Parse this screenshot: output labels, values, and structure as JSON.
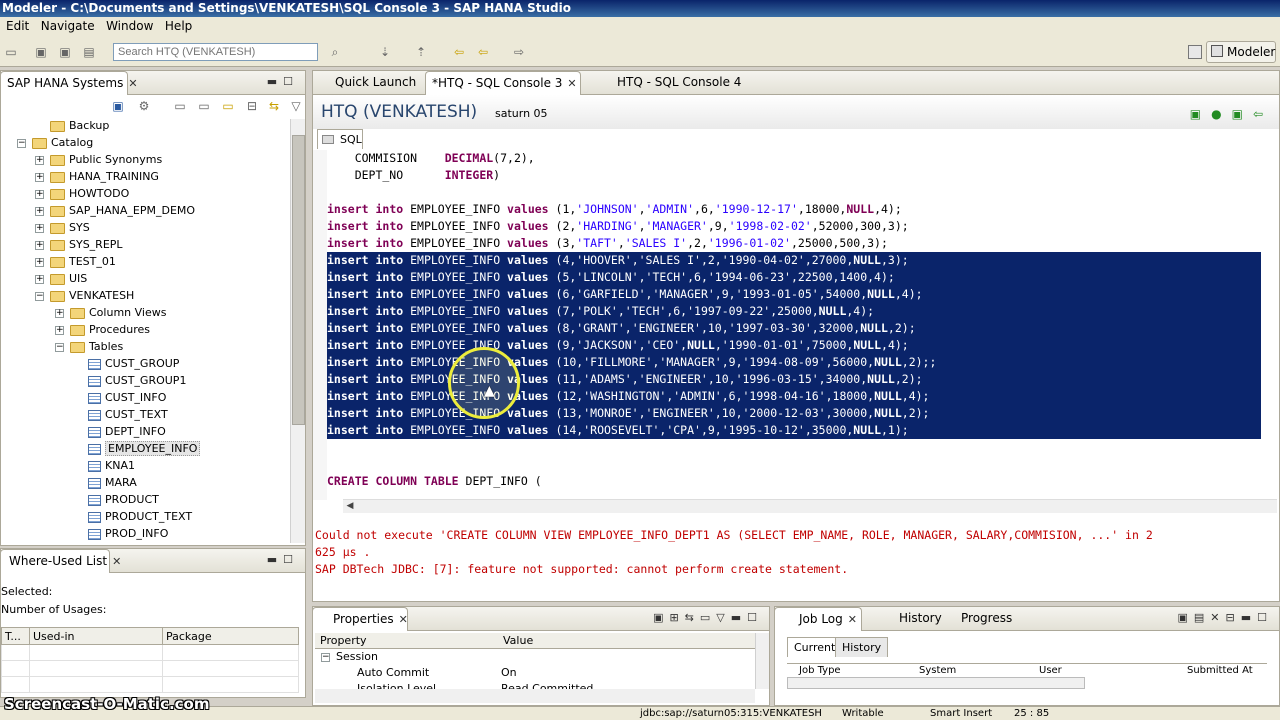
{
  "window": {
    "title": "Modeler - C:\\Documents and Settings\\VENKATESH\\SQL Console 3 - SAP HANA Studio"
  },
  "menu": [
    "Edit",
    "Navigate",
    "Window",
    "Help"
  ],
  "toolbar": {
    "search_placeholder": "Search HTQ (VENKATESH)",
    "perspective_label": "Modeler"
  },
  "systems_panel": {
    "tab_label": "SAP HANA Systems",
    "tree": [
      {
        "label": "Backup",
        "level": 2,
        "kind": "folder",
        "expander": ""
      },
      {
        "label": "Catalog",
        "level": 1,
        "kind": "folder",
        "expander": "−"
      },
      {
        "label": "Public Synonyms",
        "level": 2,
        "kind": "folder",
        "expander": "+"
      },
      {
        "label": "HANA_TRAINING",
        "level": 2,
        "kind": "folder",
        "expander": "+"
      },
      {
        "label": "HOWTODO",
        "level": 2,
        "kind": "folder",
        "expander": "+"
      },
      {
        "label": "SAP_HANA_EPM_DEMO",
        "level": 2,
        "kind": "folder",
        "expander": "+"
      },
      {
        "label": "SYS",
        "level": 2,
        "kind": "folder",
        "expander": "+"
      },
      {
        "label": "SYS_REPL",
        "level": 2,
        "kind": "folder",
        "expander": "+"
      },
      {
        "label": "TEST_01",
        "level": 2,
        "kind": "folder",
        "expander": "+"
      },
      {
        "label": "UIS",
        "level": 2,
        "kind": "folder",
        "expander": "+"
      },
      {
        "label": "VENKATESH",
        "level": 2,
        "kind": "folder",
        "expander": "−"
      },
      {
        "label": "Column Views",
        "level": 3,
        "kind": "folder",
        "expander": "+"
      },
      {
        "label": "Procedures",
        "level": 3,
        "kind": "folder",
        "expander": "+"
      },
      {
        "label": "Tables",
        "level": 3,
        "kind": "folder",
        "expander": "−"
      },
      {
        "label": "CUST_GROUP",
        "level": 4,
        "kind": "table",
        "expander": ""
      },
      {
        "label": "CUST_GROUP1",
        "level": 4,
        "kind": "table",
        "expander": ""
      },
      {
        "label": "CUST_INFO",
        "level": 4,
        "kind": "table",
        "expander": ""
      },
      {
        "label": "CUST_TEXT",
        "level": 4,
        "kind": "table",
        "expander": ""
      },
      {
        "label": "DEPT_INFO",
        "level": 4,
        "kind": "table",
        "expander": ""
      },
      {
        "label": "EMPLOYEE_INFO",
        "level": 4,
        "kind": "table",
        "expander": "",
        "selected": true
      },
      {
        "label": "KNA1",
        "level": 4,
        "kind": "table",
        "expander": ""
      },
      {
        "label": "MARA",
        "level": 4,
        "kind": "table",
        "expander": ""
      },
      {
        "label": "PRODUCT",
        "level": 4,
        "kind": "table",
        "expander": ""
      },
      {
        "label": "PRODUCT_TEXT",
        "level": 4,
        "kind": "table",
        "expander": ""
      },
      {
        "label": "PROD_INFO",
        "level": 4,
        "kind": "table",
        "expander": ""
      }
    ]
  },
  "where_used": {
    "tab_label": "Where-Used List",
    "selected_label": "Selected:",
    "usages_label": "Number of Usages:",
    "columns": [
      "T...",
      "Used-in",
      "Package"
    ]
  },
  "editor": {
    "tabs": [
      {
        "label": "Quick Launch"
      },
      {
        "label": "*HTQ - SQL Console 3",
        "active": true
      },
      {
        "label": "HTQ - SQL Console 4"
      }
    ],
    "title": "HTQ (VENKATESH)",
    "subtitle": "saturn 05",
    "sql_tab": "SQL",
    "code_lines": [
      {
        "t": "    COMMISION    DECIMAL(7,2),",
        "hl": false
      },
      {
        "t": "    DEPT_NO      INTEGER)",
        "hl": false
      },
      {
        "t": "",
        "hl": false
      },
      {
        "t": "insert into EMPLOYEE_INFO values (1,'JOHNSON','ADMIN',6,'1990-12-17',18000,NULL,4);",
        "hl": false
      },
      {
        "t": "insert into EMPLOYEE_INFO values (2,'HARDING','MANAGER',9,'1998-02-02',52000,300,3);",
        "hl": false
      },
      {
        "t": "insert into EMPLOYEE_INFO values (3,'TAFT','SALES I',2,'1996-01-02',25000,500,3);",
        "hl": false
      },
      {
        "t": "insert into EMPLOYEE_INFO values (4,'HOOVER','SALES I',2,'1990-04-02',27000,NULL,3);",
        "hl": true
      },
      {
        "t": "insert into EMPLOYEE_INFO values (5,'LINCOLN','TECH',6,'1994-06-23',22500,1400,4);",
        "hl": true
      },
      {
        "t": "insert into EMPLOYEE_INFO values (6,'GARFIELD','MANAGER',9,'1993-01-05',54000,NULL,4);",
        "hl": true
      },
      {
        "t": "insert into EMPLOYEE_INFO values (7,'POLK','TECH',6,'1997-09-22',25000,NULL,4);",
        "hl": true
      },
      {
        "t": "insert into EMPLOYEE_INFO values (8,'GRANT','ENGINEER',10,'1997-03-30',32000,NULL,2);",
        "hl": true
      },
      {
        "t": "insert into EMPLOYEE_INFO values (9,'JACKSON','CEO',NULL,'1990-01-01',75000,NULL,4);",
        "hl": true
      },
      {
        "t": "insert into EMPLOYEE_INFO values (10,'FILLMORE','MANAGER',9,'1994-08-09',56000,NULL,2);;",
        "hl": true
      },
      {
        "t": "insert into EMPLOYEE_INFO values (11,'ADAMS','ENGINEER',10,'1996-03-15',34000,NULL,2);",
        "hl": true
      },
      {
        "t": "insert into EMPLOYEE_INFO values (12,'WASHINGTON','ADMIN',6,'1998-04-16',18000,NULL,4);",
        "hl": true
      },
      {
        "t": "insert into EMPLOYEE_INFO values (13,'MONROE','ENGINEER',10,'2000-12-03',30000,NULL,2);",
        "hl": true
      },
      {
        "t": "insert into EMPLOYEE_INFO values (14,'ROOSEVELT','CPA',9,'1995-10-12',35000,NULL,1);",
        "hl": true
      },
      {
        "t": "",
        "hl": false
      },
      {
        "t": "",
        "hl": false
      },
      {
        "t": "CREATE COLUMN TABLE DEPT_INFO (",
        "hl": false
      }
    ],
    "error_lines": [
      "Could not execute 'CREATE COLUMN VIEW EMPLOYEE_INFO_DEPT1 AS (SELECT EMP_NAME, ROLE, MANAGER, SALARY,COMMISION, ...' in 2",
      "625 µs .",
      "SAP DBTech JDBC: [7]: feature not supported: cannot perform create statement."
    ]
  },
  "properties": {
    "tab_label": "Properties",
    "columns": [
      "Property",
      "Value"
    ],
    "rows": [
      {
        "property": "Session",
        "value": ""
      },
      {
        "property": "Auto Commit",
        "value": "On"
      },
      {
        "property": "Isolation Level",
        "value": "Read Committed"
      }
    ]
  },
  "job_log": {
    "tabs": [
      "Job Log",
      "History",
      "Progress"
    ],
    "subtabs": [
      "Current",
      "History"
    ],
    "columns": [
      "Job Type",
      "System",
      "User",
      "Submitted At"
    ]
  },
  "status": {
    "connection": "jdbc:sap://saturn05:315:VENKATESH",
    "mode": "Writable",
    "insert": "Smart Insert",
    "position": "25 : 85"
  },
  "watermark": "Screencast-O-Matic.com"
}
